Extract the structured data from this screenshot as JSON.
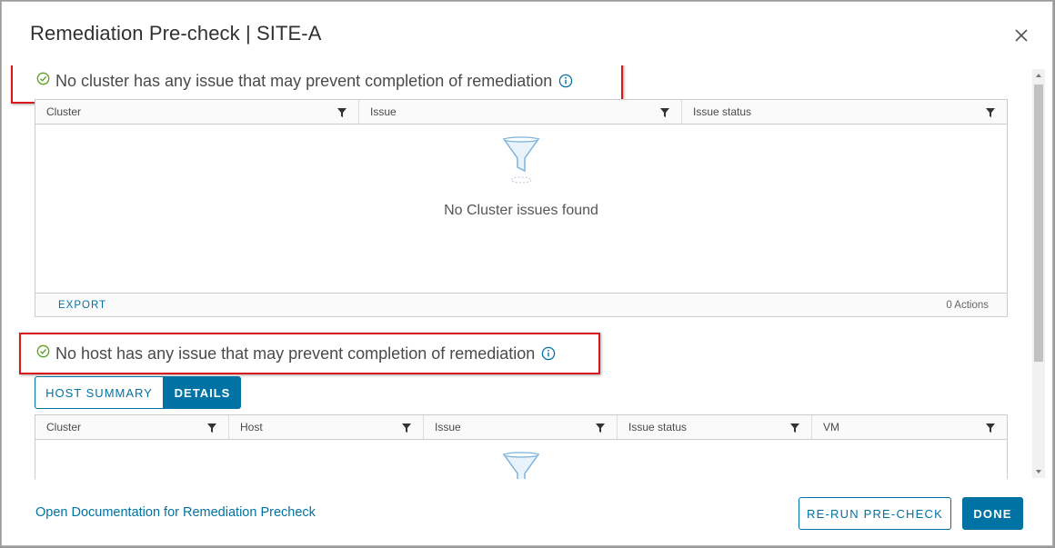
{
  "dialog": {
    "title": "Remediation Pre-check | SITE-A",
    "close_icon": "close-icon"
  },
  "cluster_section": {
    "banner_text": "No cluster has any issue that may prevent completion of remediation",
    "columns": [
      "Cluster",
      "Issue",
      "Issue status"
    ],
    "empty_text": "No Cluster issues found",
    "export_label": "EXPORT",
    "actions_label": "0 Actions"
  },
  "host_section": {
    "banner_text": "No host has any issue that may prevent completion of remediation",
    "tabs": [
      {
        "label": "HOST SUMMARY",
        "selected": false
      },
      {
        "label": "DETAILS",
        "selected": true
      }
    ],
    "columns": [
      "Cluster",
      "Host",
      "Issue",
      "Issue status",
      "VM"
    ]
  },
  "footer": {
    "doc_link": "Open Documentation for Remediation Precheck",
    "rerun_label": "RE-RUN PRE-CHECK",
    "done_label": "DONE"
  },
  "colors": {
    "accent": "#0072a3",
    "success": "#5aa220",
    "highlight_border": "#d9181e"
  }
}
